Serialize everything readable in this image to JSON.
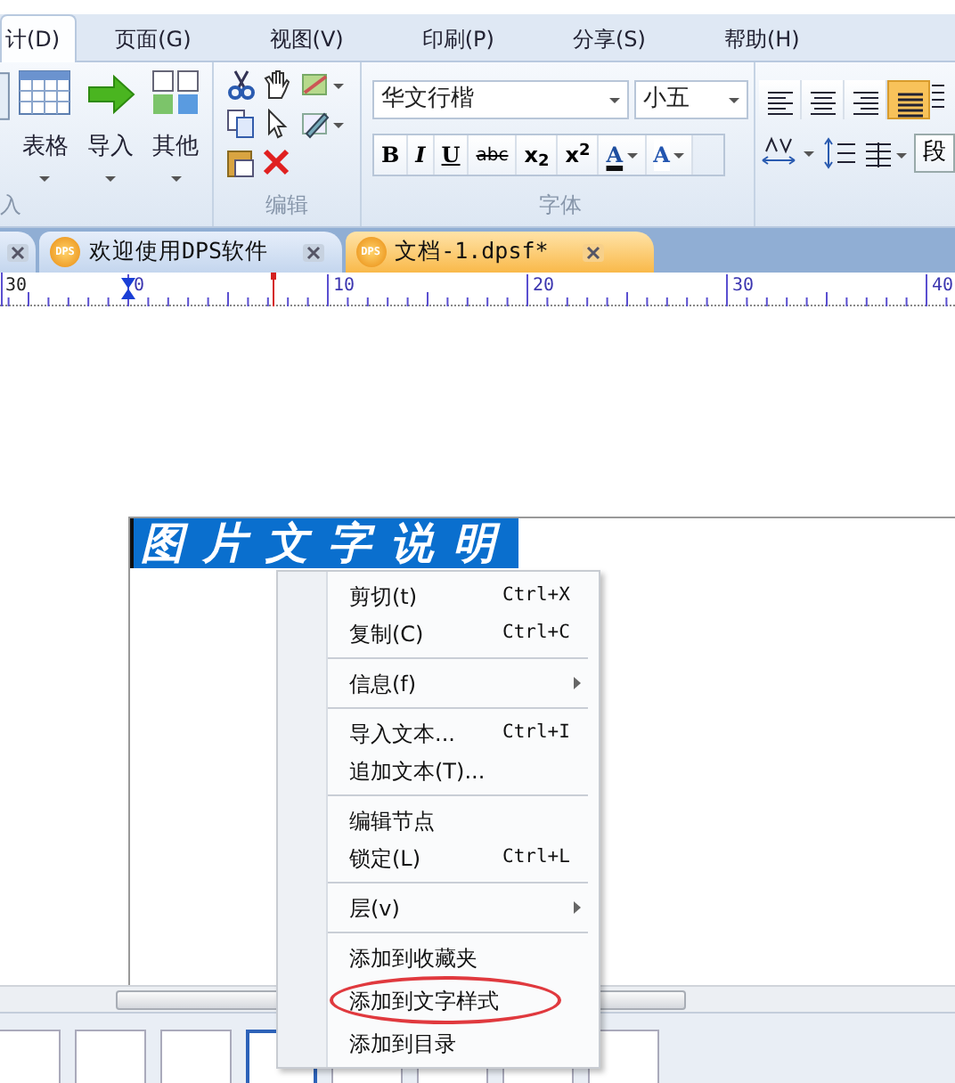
{
  "menu_tabs": [
    {
      "label": "计(D)",
      "selected": true
    },
    {
      "label": "页面(G)",
      "selected": false
    },
    {
      "label": "视图(V)",
      "selected": false
    },
    {
      "label": "印刷(P)",
      "selected": false
    },
    {
      "label": "分享(S)",
      "selected": false
    },
    {
      "label": "帮助(H)",
      "selected": false
    }
  ],
  "ribbon": {
    "insert_group": {
      "label": "入",
      "buttons": [
        {
          "label": "表格",
          "kind": "table"
        },
        {
          "label": "导入",
          "kind": "import"
        },
        {
          "label": "其他",
          "kind": "other"
        }
      ]
    },
    "edit_group": {
      "label": "编辑"
    },
    "font_group": {
      "label": "字体",
      "font": "华文行楷",
      "size": "小五",
      "format_buttons": [
        {
          "label": "B",
          "kind": "bold",
          "dropdown": false
        },
        {
          "label": "I",
          "kind": "italic",
          "dropdown": false
        },
        {
          "label": "U",
          "kind": "underline",
          "dropdown": false
        },
        {
          "label": "abc",
          "kind": "strike",
          "dropdown": false
        },
        {
          "label": "x$_{2}$",
          "kind": "sub",
          "dropdown": false
        },
        {
          "label": "x$^{2}$",
          "kind": "sup",
          "dropdown": false
        },
        {
          "label": "A",
          "kind": "color",
          "dropdown": true
        },
        {
          "label": "A",
          "kind": "highlight",
          "dropdown": true
        }
      ]
    },
    "paragraph_group": {
      "alignment_buttons": [
        {
          "selected": false
        },
        {
          "selected": false
        },
        {
          "selected": false
        },
        {
          "selected": true
        }
      ],
      "paragraph_button": "段"
    }
  },
  "doc_tabs": [
    {
      "label": "欢迎使用DPS软件",
      "icon_text": "DPS",
      "selected": false
    },
    {
      "label": "文档-1.dpsf*",
      "icon_text": "DPS",
      "selected": true
    }
  ],
  "ruler": {
    "labels": [
      "30",
      "0",
      "10",
      "20",
      "30",
      "40"
    ]
  },
  "text_frame": {
    "text": "图片文字说明",
    "selected": true
  },
  "context_menu": [
    {
      "kind": "item",
      "label": "剪切(t)",
      "shortcut": "Ctrl+X",
      "submenu": false,
      "circled": false
    },
    {
      "kind": "item",
      "label": "复制(C)",
      "shortcut": "Ctrl+C",
      "submenu": false,
      "circled": false
    },
    {
      "kind": "separator"
    },
    {
      "kind": "item",
      "label": "信息(f)",
      "submenu": true,
      "circled": false
    },
    {
      "kind": "separator"
    },
    {
      "kind": "item",
      "label": "导入文本...",
      "shortcut": "Ctrl+I",
      "submenu": false,
      "circled": false
    },
    {
      "kind": "item",
      "label": "追加文本(T)...",
      "submenu": false,
      "circled": false
    },
    {
      "kind": "separator"
    },
    {
      "kind": "item",
      "label": "编辑节点",
      "submenu": false,
      "circled": false
    },
    {
      "kind": "item",
      "label": "锁定(L)",
      "shortcut": "Ctrl+L",
      "submenu": false,
      "circled": false
    },
    {
      "kind": "separator"
    },
    {
      "kind": "item",
      "label": "层(v)",
      "submenu": true,
      "circled": false
    },
    {
      "kind": "separator"
    },
    {
      "kind": "item",
      "label": "添加到收藏夹",
      "submenu": false,
      "circled": false
    },
    {
      "kind": "item",
      "label": "添加到文字样式",
      "submenu": false,
      "circled": true
    },
    {
      "kind": "item",
      "label": "添加到目录",
      "submenu": false,
      "circled": false
    }
  ],
  "page_thumbnails": [
    {
      "selected": false
    },
    {
      "selected": false
    },
    {
      "selected": false
    },
    {
      "selected": true
    },
    {
      "selected": false
    },
    {
      "selected": false
    },
    {
      "selected": false
    },
    {
      "selected": false
    }
  ]
}
